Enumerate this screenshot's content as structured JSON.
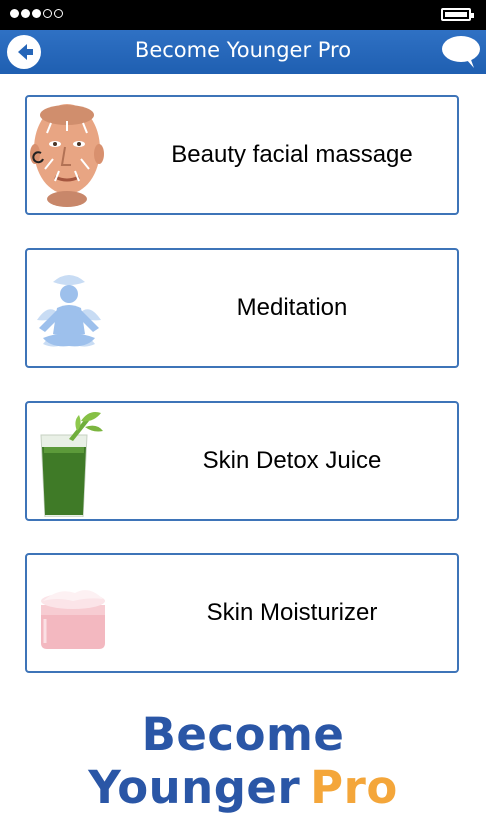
{
  "status_bar": {
    "signal_icon": "signal-dots-icon",
    "battery_icon": "battery-icon"
  },
  "header": {
    "title": "Become Younger Pro",
    "back_icon": "back-arrow-icon",
    "chat_icon": "chat-bubble-icon",
    "color": "#2a6bbf"
  },
  "menu": {
    "items": [
      {
        "label": "Beauty facial massage",
        "icon": "face-massage-icon"
      },
      {
        "label": "Meditation",
        "icon": "meditation-icon"
      },
      {
        "label": "Skin Detox Juice",
        "icon": "green-juice-icon"
      },
      {
        "label": "Skin Moisturizer",
        "icon": "moisturizer-jar-icon"
      }
    ]
  },
  "brand": {
    "main": "Become Younger",
    "pro": "Pro",
    "main_color": "#2a56a6",
    "pro_color": "#f4a63a"
  }
}
